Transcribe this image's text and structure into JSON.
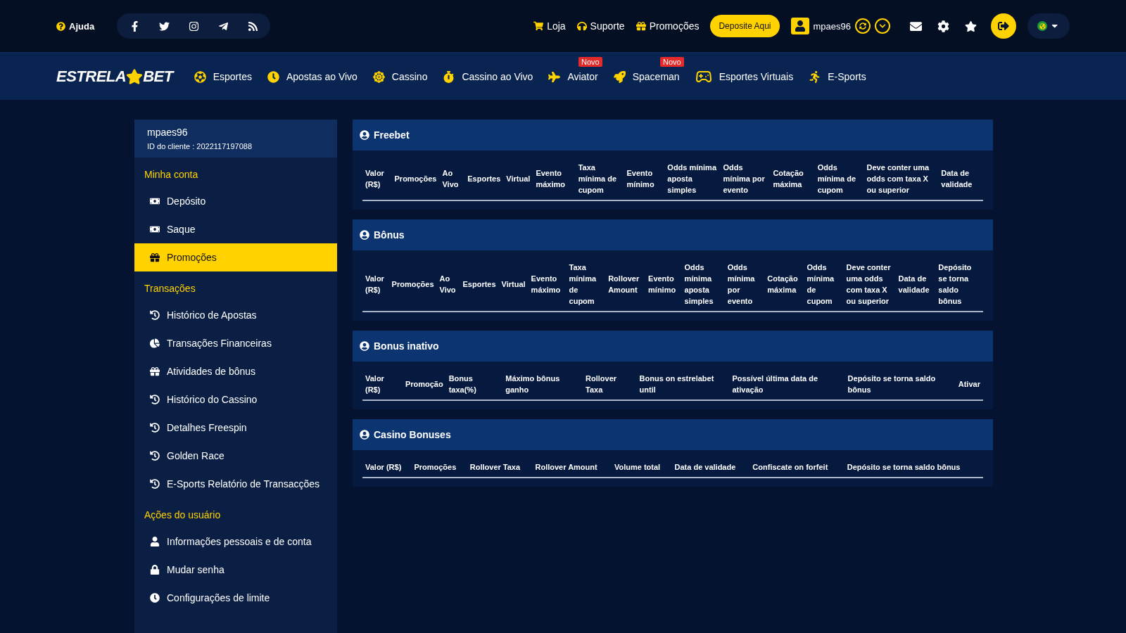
{
  "top_bar": {
    "help": "Ajuda",
    "links": [
      "Loja",
      "Suporte",
      "Promoções"
    ],
    "deposit_button": "Deposite Aqui",
    "username": "mpaes96"
  },
  "logo": {
    "left": "ESTRELA",
    "right": "BET"
  },
  "nav": [
    {
      "label": "Esportes"
    },
    {
      "label": "Apostas ao Vivo"
    },
    {
      "label": "Cassino"
    },
    {
      "label": "Cassino ao Vivo"
    },
    {
      "label": "Aviator",
      "badge": "Novo"
    },
    {
      "label": "Spaceman",
      "badge": "Novo"
    },
    {
      "label": "Esportes Virtuais"
    },
    {
      "label": "E-Sports"
    }
  ],
  "account": {
    "username": "mpaes96",
    "client_id": "ID do cliente : 2022117197088"
  },
  "sidebar": [
    {
      "title": "Minha conta",
      "items": [
        {
          "label": "Depósito",
          "selected": false
        },
        {
          "label": "Saque",
          "selected": false
        },
        {
          "label": "Promoções",
          "selected": true
        }
      ]
    },
    {
      "title": "Transações",
      "items": [
        {
          "label": "Histórico de Apostas",
          "selected": false
        },
        {
          "label": "Transações Financeiras",
          "selected": false
        },
        {
          "label": "Atividades de bônus",
          "selected": false
        },
        {
          "label": "Histórico do Cassino",
          "selected": false
        },
        {
          "label": "Detalhes Freespin",
          "selected": false
        },
        {
          "label": "Golden Race",
          "selected": false
        },
        {
          "label": "E-Sports Relatório de Transacções",
          "selected": false
        }
      ]
    },
    {
      "title": "Ações do usuário",
      "items": [
        {
          "label": "Informações pessoais e de conta",
          "selected": false
        },
        {
          "label": "Mudar senha",
          "selected": false
        },
        {
          "label": "Configurações de limite",
          "selected": false
        }
      ]
    }
  ],
  "panels": [
    {
      "title": "Freebet",
      "columns": [
        "Valor (R$)",
        "Promoções",
        "Ao Vivo",
        "Esportes",
        "Virtual",
        "Evento máximo",
        "Taxa mínima de cupom",
        "Evento mínimo",
        "Odds mínima aposta simples",
        "Odds mínima por evento",
        "Cotação máxima",
        "Odds mínima de cupom",
        "Deve conter uma odds com taxa X ou superior",
        "Data de validade"
      ]
    },
    {
      "title": "Bônus",
      "columns": [
        "Valor (R$)",
        "Promoções",
        "Ao Vivo",
        "Esportes",
        "Virtual",
        "Evento máximo",
        "Taxa mínima de cupom",
        "Rollover Amount",
        "Evento mínimo",
        "Odds mínima aposta simples",
        "Odds mínima por evento",
        "Cotação máxima",
        "Odds mínima de cupom",
        "Deve conter uma odds com taxa X ou superior",
        "Data de validade",
        "Depósito se torna saldo bônus"
      ]
    },
    {
      "title": "Bonus inativo",
      "columns": [
        "Valor (R$)",
        "Promoção",
        "Bonus taxa(%)",
        "Máximo bônus ganho",
        "Rollover Taxa",
        "Bonus on estrelabet until",
        "Possível última data de ativação",
        "Depósito se torna saldo bônus",
        "Ativar"
      ]
    },
    {
      "title": "Casino Bonuses",
      "columns": [
        "Valor (R$)",
        "Promoções",
        "Rollover Taxa",
        "Rollover Amount",
        "Volume total",
        "Data de validade",
        "Confiscate on forfeit",
        "Depósito se torna saldo bônus"
      ]
    }
  ]
}
